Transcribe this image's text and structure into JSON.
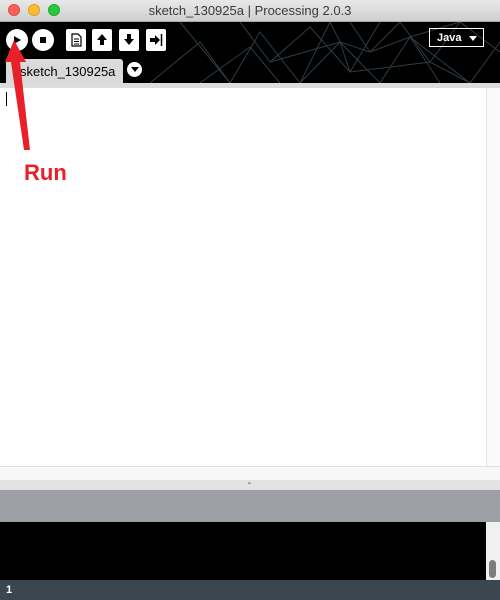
{
  "window": {
    "title": "sketch_130925a | Processing 2.0.3"
  },
  "toolbar": {
    "buttons": [
      {
        "name": "run",
        "icon": "play-icon"
      },
      {
        "name": "stop",
        "icon": "stop-icon"
      },
      {
        "name": "new",
        "icon": "new-file-icon"
      },
      {
        "name": "open",
        "icon": "upload-arrow-icon"
      },
      {
        "name": "save",
        "icon": "download-arrow-icon"
      },
      {
        "name": "export",
        "icon": "export-icon"
      }
    ],
    "mode": "Java"
  },
  "tabs": [
    {
      "label": "sketch_130925a"
    }
  ],
  "editor": {
    "content": ""
  },
  "status": {
    "line_number": "1"
  },
  "annotation": {
    "label": "Run",
    "color": "#e8202a"
  },
  "colors": {
    "toolbar_bg": "#000000",
    "status_bg": "#3c4650",
    "message_bg": "#9ca0a5"
  }
}
